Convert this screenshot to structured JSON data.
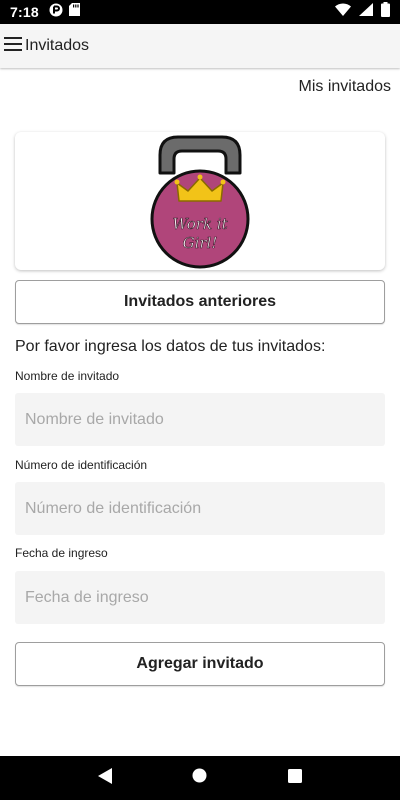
{
  "status_bar": {
    "time": "7:18",
    "left_icons": [
      "notification-app-icon",
      "sd-card-icon"
    ],
    "right_icons": [
      "wifi-icon",
      "signal-icon",
      "battery-icon"
    ]
  },
  "app_bar": {
    "title": "Invitados",
    "menu_icon": "hamburger-menu-icon"
  },
  "header_link": "Mis invitados",
  "logo": {
    "line1": "Work it",
    "line2": "Girl!",
    "colors": {
      "body": "#b0457a",
      "handle": "#6b6b6b",
      "crown": "#f2c318",
      "outline": "#111111"
    }
  },
  "previous_button": "Invitados anteriores",
  "instructions": "Por favor ingresa los datos de tus invitados:",
  "form": {
    "name": {
      "label": "Nombre de invitado",
      "placeholder": "Nombre de invitado",
      "value": ""
    },
    "id_number": {
      "label": "Número de identificación",
      "placeholder": "Número de identificación",
      "value": ""
    },
    "entry_date": {
      "label": "Fecha de ingreso",
      "placeholder": "Fecha de ingreso",
      "value": ""
    }
  },
  "add_button": "Agregar invitado",
  "nav_bar": [
    "back-icon",
    "home-icon",
    "recents-icon"
  ]
}
